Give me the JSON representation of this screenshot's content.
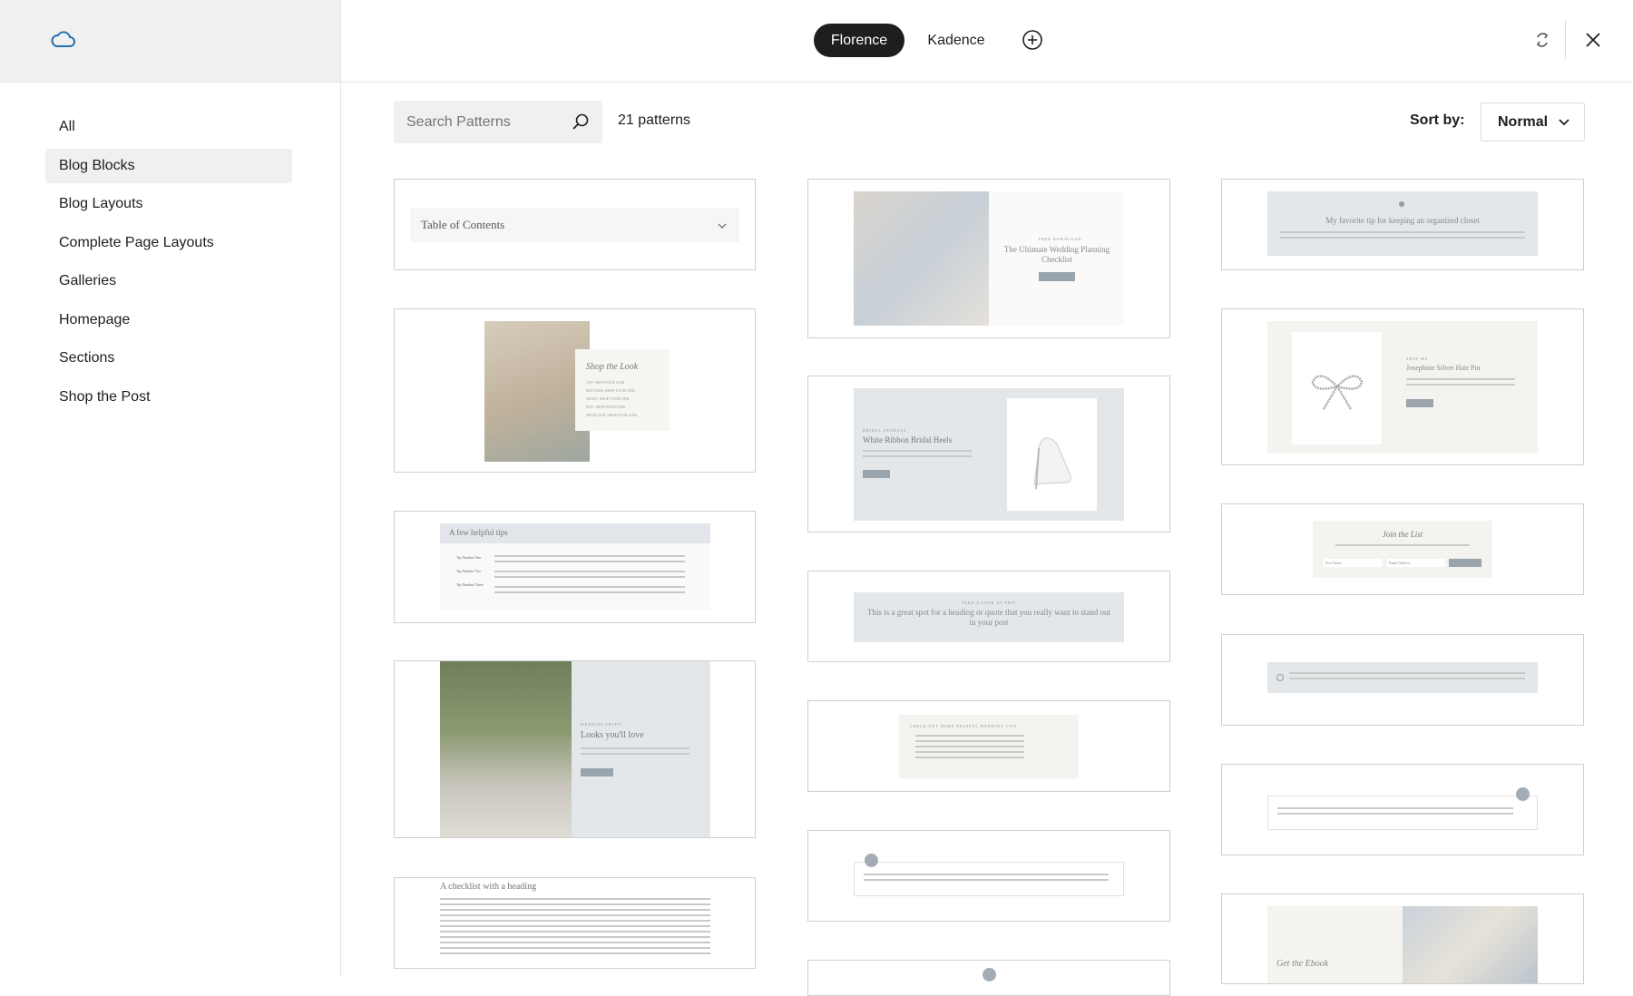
{
  "sidebar": {
    "categories": [
      "All",
      "Blog Blocks",
      "Blog Layouts",
      "Complete Page Layouts",
      "Galleries",
      "Homepage",
      "Sections",
      "Shop the Post"
    ],
    "active_index": 1
  },
  "header": {
    "tabs": [
      "Florence",
      "Kadence"
    ],
    "active_tab": "Florence"
  },
  "toolbar": {
    "search_placeholder": "Search Patterns",
    "count_text": "21 patterns",
    "sort_label": "Sort by:",
    "sort_value": "Normal"
  },
  "previews": {
    "toc_title": "Table of Contents",
    "shop_title": "Shop the Look",
    "shop_items": [
      "TOP: SHOP YOUR LINK",
      "BOTTOMS: SHOP YOUR LINK",
      "SHOES: SHOP YOUR LINK",
      "BAG: SHOP YOUR LINK",
      "NECKLACE: SHOP YOUR LINK"
    ],
    "tips_title": "A few helpful tips",
    "tips_items": [
      "Tip Number One",
      "Tip Number Two",
      "Tip Number Three"
    ],
    "looks_kicker": "WEDDING INSPO",
    "looks_title": "Looks you'll love",
    "checklist_title": "A checklist with a heading",
    "wedding_kicker": "FREE DOWNLOAD",
    "wedding_title": "The Ultimate Wedding Planning Checklist",
    "heels_kicker": "BRIDAL SANDALS",
    "heels_title": "White Ribbon Bridal Heels",
    "quote_kicker": "TAKE A LOOK AT THIS",
    "quote_text": "This is a great spot for a heading or quote that you really want to stand out in your post",
    "links_title": "CHECK OUT MORE HELPFUL WEDDING TIPS",
    "closet_title": "My favorite tip for keeping an organized closet",
    "hairpin_kicker": "SHOP MY",
    "hairpin_title": "Josephine Silver Hair Pin",
    "join_title": "Join the List",
    "join_field1": "First Name",
    "join_field2": "Email Address",
    "ebook_title": "Get the Ebook"
  }
}
